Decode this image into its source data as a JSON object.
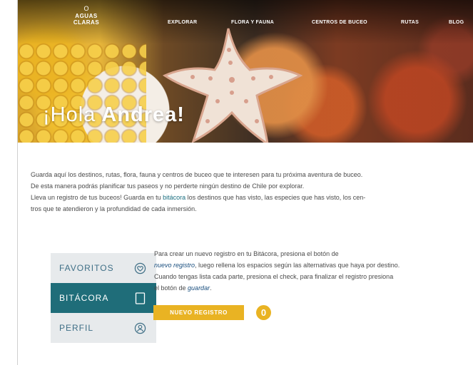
{
  "logo": {
    "mark": "O",
    "line1": "AGUAS",
    "line2": "CLARAS"
  },
  "nav": {
    "items": [
      {
        "label": "EXPLORAR"
      },
      {
        "label": "FLORA Y FAUNA"
      },
      {
        "label": "CENTROS DE BUCEO"
      },
      {
        "label": "RUTAS"
      },
      {
        "label": "BLOG"
      }
    ]
  },
  "hero": {
    "greeting": "¡Hola",
    "name": "Andrea!"
  },
  "intro": {
    "line1": "Guarda aquí los destinos, rutas, flora, fauna y centros de buceo que te interesen para tu próxima aventura de buceo.",
    "line2": "De esta manera podrás planificar tus paseos y no perderte ningún destino de Chile por explorar.",
    "line3_a": "Lleva un registro de tus buceos! Guarda en tu ",
    "line3_link": "bitácora",
    "line3_b": " los destinos que has visto, las especies que has visto, los cen-",
    "line4": "tros que te atendieron y la profundidad de cada inmersión."
  },
  "menu": {
    "items": [
      {
        "label": "FAVORITOS",
        "icon": "heart-icon"
      },
      {
        "label": "BITÁCORA",
        "icon": "notebook-icon"
      },
      {
        "label": "PERFIL",
        "icon": "user-icon"
      }
    ]
  },
  "instructions": {
    "line1": "Para crear un nuevo registro en tu Bitácora, presiona el botón de",
    "line2_link": "nuevo registro",
    "line2_rest": ", luego rellena los espacios según las alternativas que haya por destino.",
    "line3": "Cuando tengas lista cada parte, presiona el check, para finalizar el registro presiona",
    "line4_a": "el botón de ",
    "line4_link": "guardar",
    "line4_b": "."
  },
  "button": {
    "label": "NUEVO REGISTRO"
  },
  "badge": {
    "value": "0"
  },
  "colors": {
    "accent": "#e9b323",
    "teal": "#1f6d79",
    "menu_bg": "#e7eaec",
    "link": "#1a6f80"
  }
}
